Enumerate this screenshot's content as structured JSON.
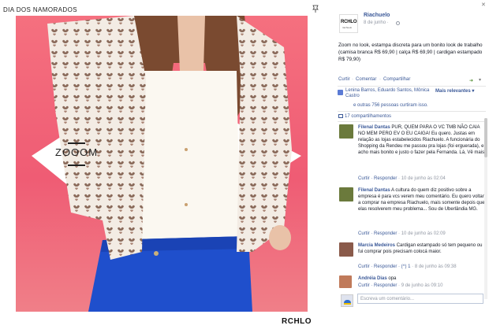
{
  "photo": {
    "title": "DIA DOS NAMORADOS",
    "zoom_text": "ZOOOM",
    "brand_logo": "RCHLO",
    "bg_colors": [
      "#f5707f",
      "#ef5c74"
    ],
    "icons": [
      "pin-icon"
    ]
  },
  "post": {
    "page_avatar_logo": "RCHLO",
    "page_avatar_sub": "riachuelo",
    "page_name": "Riachuelo",
    "date": "8 de junho ·",
    "text": "Zoom no look, estampa discreta para um bonito look de trabalho (camisa branca R$ 69,90 | calça R$ 69,90 | cardigan estampado R$ 79,90)",
    "actions": {
      "like": "Curtir",
      "comment": "Comentar",
      "share": "Compartilhar"
    },
    "likes_text": "Lenina Barros, Eduardo Santos, Mônica Castro",
    "sort_label": "Mais relevantes",
    "likes_count_prefix": "e outras",
    "likes_count": "756 pessoas curtiram isso.",
    "shares": "17 compartilhamentos"
  },
  "comments": [
    {
      "author": "Filenal Dantas",
      "text": "PUR, QUEM PARA O VC TMB NÃO CAIA NO MEM PERO EV O EU CAIGA! Eu quero. Justas em relação as lojas estabelecidos Riachuelo. A funcionária do Shopping da Rendeu me passou pra lojas (foi erguerada), e acho mais bonito e justo o fazer pela Fernanda. Lá, Vê mais",
      "meta_reply": "Curtir · Responder",
      "meta_time": "· 10 de junho às 02:04",
      "avatar_color": "#6b7a3c"
    },
    {
      "author": "Filenal Dantas",
      "text": "A cultura do quem diz positivo sobre a empresa é para vcs verem meu comentário. Eu quero voltar a comprar na empresa Riachuelo, mais somente depois que elas resolverem meu problema... Sou de Uberlândia MG.",
      "meta_reply": "Curtir · Responder",
      "meta_time": "· 10 de junho às 02:09",
      "avatar_color": "#6b7a3c"
    },
    {
      "author": "Marcia Medeiros",
      "text": "Cardigan estampado só tem pequeno ou fui comprar pois precisam colocá maior.",
      "meta_reply": "Curtir · Responder · (^) 1",
      "meta_time": "· 8 de junho às 09:38",
      "avatar_color": "#8a5a4a"
    },
    {
      "author": "Andréia Dias",
      "text": "opa",
      "meta_reply": "Curtir · Responder",
      "meta_time": "· 9 de junho às 09:10",
      "avatar_color": "#c07a5a"
    }
  ],
  "composer": {
    "placeholder": "Escreva um comentário..."
  },
  "colors": {
    "link": "#3b5998",
    "muted": "#9197a3"
  }
}
